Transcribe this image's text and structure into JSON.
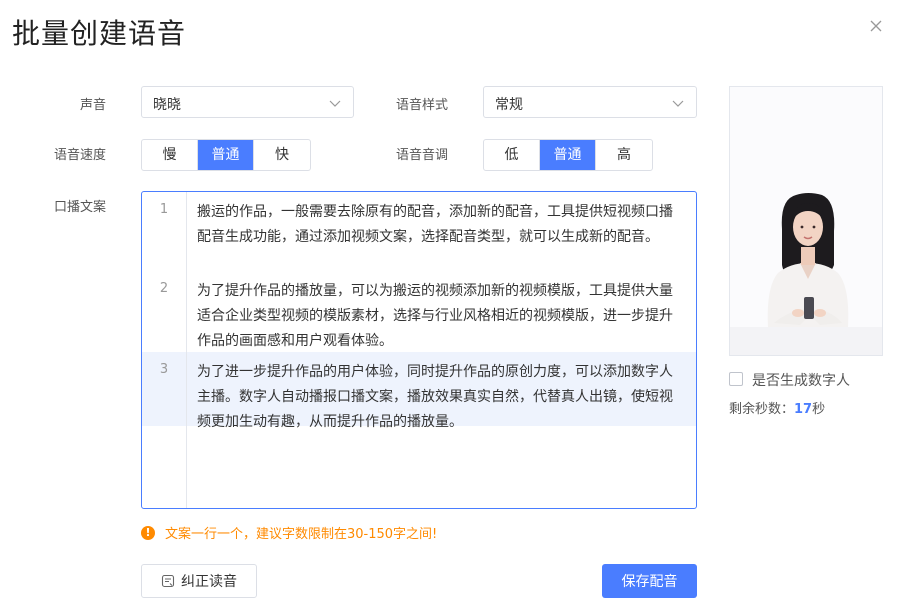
{
  "dialog": {
    "title": "批量创建语音",
    "close_icon": "close-icon"
  },
  "form": {
    "voice": {
      "label": "声音",
      "value": "晓晓"
    },
    "style": {
      "label": "语音样式",
      "value": "常规"
    },
    "speed": {
      "label": "语音速度",
      "options": [
        "慢",
        "普通",
        "快"
      ],
      "selected": "普通"
    },
    "pitch": {
      "label": "语音音调",
      "options": [
        "低",
        "普通",
        "高"
      ],
      "selected": "普通"
    },
    "script": {
      "label": "口播文案",
      "lines": [
        {
          "num": "1",
          "text": "搬运的作品，一般需要去除原有的配音，添加新的配音，工具提供短视频口播配音生成功能，通过添加视频文案，选择配音类型，就可以生成新的配音。"
        },
        {
          "num": "2",
          "text": "为了提升作品的播放量，可以为搬运的视频添加新的视频模版，工具提供大量适合企业类型视频的模版素材，选择与行业风格相近的视频模版，进一步提升作品的画面感和用户观看体验。"
        },
        {
          "num": "3",
          "text": "为了进一步提升作品的用户体验，同时提升作品的原创力度，可以添加数字人主播。数字人自动播报口播文案，播放效果真实自然，代替真人出镜，使短视频更加生动有趣，从而提升作品的播放量。"
        }
      ]
    }
  },
  "side": {
    "digital_human_label": "是否生成数字人",
    "remaining_label": "剩余秒数：",
    "remaining_value": "17",
    "remaining_unit": "秒"
  },
  "warning": "文案一行一个，建议字数限制在30-150字之间!",
  "buttons": {
    "correct": "纠正读音",
    "save": "保存配音"
  },
  "colors": {
    "accent": "#4a7dff",
    "warning": "#ff8a00",
    "line_highlight": "#eef3fd"
  }
}
